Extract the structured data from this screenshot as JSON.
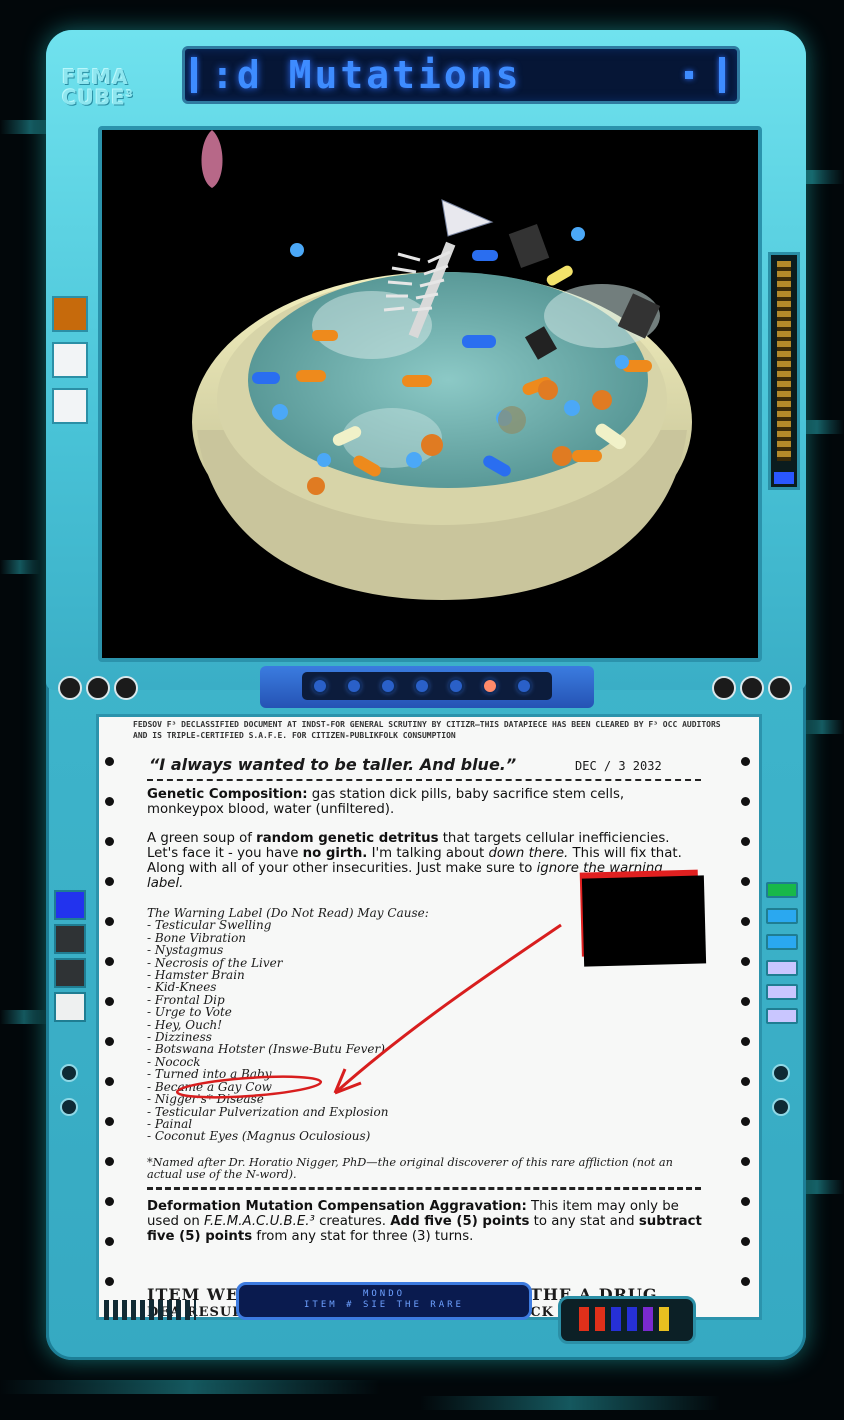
{
  "device": {
    "logo_line1": "FEMA",
    "logo_line2": "CUBE",
    "logo_sup": "3",
    "title": ":d Mutations"
  },
  "colors": {
    "device_body": "#49c3d7",
    "title_text": "#3e8cff",
    "active_side_button": "#c66a0c",
    "annotation_red": "#d81e1e"
  },
  "document": {
    "header_fineprint": "FEDSOV F³ DECLASSIFIED DOCUMENT AT INDST-FOR GENERAL SCRUTINY BY CITIZR—THIS DATAPIECE HAS BEEN CLEARED BY F³ OCC AUDITORS AND IS TRIPLE-CERTIFIED S.A.F.E. FOR CITIZEN-PUBLIKFOLK CONSUMPTION",
    "quote": "“I always wanted to be taller. And blue.”",
    "date": "DEC / 3 2032",
    "composition_label": "Genetic Composition:",
    "composition_text": " gas station dick pills, baby sacrifice stem cells, monkeypox blood, water (unfiltered).",
    "desc_1": "A green soup of ",
    "desc_bold_1": "random genetic detritus",
    "desc_2": " that targets cellular inefficiencies. Let's face it - you have ",
    "desc_bold_2": "no girth.",
    "desc_3": " I'm talking about ",
    "desc_italic_1": "down there.",
    "desc_4": " This will fix that. Along with all of your other insecurities. Just make sure to ",
    "desc_italic_2": "ignore the warning label.",
    "warning_heading": "The Warning Label (Do Not Read) May Cause:",
    "warnings": [
      "- Testicular Swelling",
      "- Bone Vibration",
      "- Nystagmus",
      "- Necrosis of the Liver",
      "- Hamster Brain",
      "- Kid-Knees",
      "- Frontal Dip",
      "- Urge to Vote",
      "- Hey, Ouch!",
      "- Dizziness",
      "- Botswana Hotster (Inswe-Butu Fever)",
      "- Nocock",
      "- Turned into a Baby",
      "- Became a Gay Cow",
      "- Nigger's* Disease",
      "- Testicular Pulverization and Explosion",
      "- Painal",
      "- Coconut Eyes (Magnus Oculosious)"
    ],
    "footnote": "*Named after Dr. Horatio Nigger, PhD—the original discoverer of this rare affliction (not an actual use of the N-word).",
    "rule_label": "Deformation Mutation Compensation Aggravation:",
    "rule_1": " This item may only be used on ",
    "rule_italic": "F.E.M.A.C.U.B.E.³",
    "rule_2": " creatures. ",
    "rule_bold_1": "Add five (5) points",
    "rule_3": " to any stat and ",
    "rule_bold_2": "subtract five (5) points",
    "rule_4": " from any stat for three (3) turns.",
    "cutoff_line_1": "ITEM WE FOUND THAT A CHANGE IN THE A DRUG",
    "cutoff_line_2": "DEA RESULT                                       AL SHOCK"
  },
  "footer": {
    "tag_line1": "MONDO",
    "tag_line2": "ITEM #  SIE  THE  RARE"
  }
}
